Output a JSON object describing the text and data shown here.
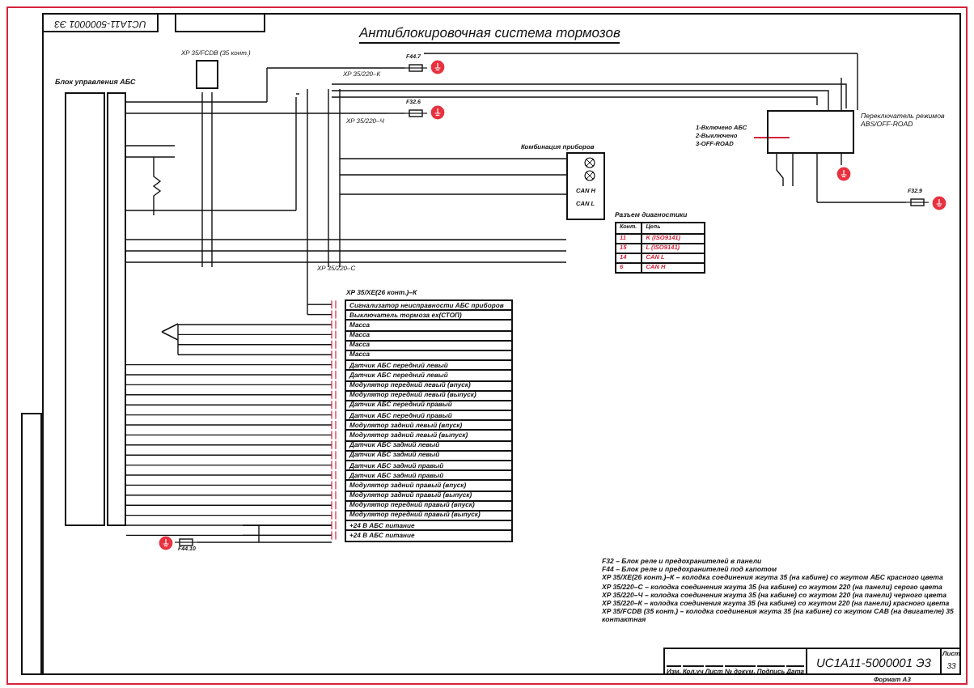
{
  "title": "Антиблокировочная система тормозов",
  "doc_code_mirrored": "UC1A11-5000001 Э3",
  "ecu": {
    "label": "Блок управления АБС"
  },
  "connectors": [
    "XP 35/FCDB (35 конт.)",
    "XP 35/220–К",
    "XP 35/220–Ч",
    "XP 35/220–С"
  ],
  "fuses": [
    "F44.7",
    "F32.6",
    "F44.10",
    "F32.9"
  ],
  "instrument_cluster": {
    "label": "Комбинация приборов",
    "signals": [
      "CAN H",
      "CAN L"
    ]
  },
  "switch": {
    "label": "Переключатель режимов ABS/OFF-ROAD",
    "positions": [
      "1-Включено АБС",
      "2-Выключено",
      "3-OFF-ROAD"
    ]
  },
  "diag": {
    "title": "Разъем диагностики",
    "columns": [
      "Конт.",
      "Цепь"
    ],
    "rows": [
      [
        "11",
        "K (ISO9141)"
      ],
      [
        "15",
        "L (ISO9141)"
      ],
      [
        "14",
        "CAN L"
      ],
      [
        "6",
        "CAN H"
      ]
    ]
  },
  "harness": {
    "title": "XP 35/XE(26 конт.)–К",
    "rows": [
      "Сигнализатор неисправности АБС приборов",
      "Выключатель тормоза ex(СТОП)",
      "Масса",
      "Масса",
      "Масса",
      "Масса",
      "Датчик АБС передний левый",
      "Датчик АБС передний левый",
      "Модулятор передний левый (впуск)",
      "Модулятор передний левый (выпуск)",
      "Датчик АБС передний правый",
      "Датчик АБС передний правый",
      "Модулятор задний левый (впуск)",
      "Модулятор задний левый (выпуск)",
      "Датчик АБС задний левый",
      "Датчик АБС задний левый",
      "Датчик АБС задний правый",
      "Датчик АБС задний правый",
      "Модулятор задний правый (впуск)",
      "Модулятор задний правый (выпуск)",
      "Модулятор передний правый (впуск)",
      "Модулятор передний правый (выпуск)",
      "+24 В АБС питание",
      "+24 В АБС питание"
    ]
  },
  "legend": [
    "F32 – Блок реле и предохранителей в панели",
    "F44 – Блок реле и предохранителей под капотом",
    "XP 35/XE(26 конт.)–К – колодка соединения жгута 35 (на кабине) со жгутом АБС красного цвета",
    "XP 35/220–С – колодка соединения жгута 35 (на кабине) со жгутом 220 (на панели) серого цвета",
    "XP 35/220–Ч – колодка соединения жгута 35 (на кабине) со жгутом 220 (на панели) черного цвета",
    "XP 35/220–К – колодка соединения жгута 35 (на кабине) со жгутом 220 (на панели) красного цвета",
    "XP 35/FCDB (35 конт.) – колодка соединения жгута 35 (на кабине) со жгутом CAB (на двигателе) 35 контактная"
  ],
  "stamp": {
    "columns": [
      "Изм.",
      "Кол.уч",
      "Лист",
      "№ докум.",
      "Подпись",
      "Дата"
    ],
    "code": "UC1A11-5000001 Э3",
    "sheet_label": "Лист",
    "sheet": "33",
    "format": "Формат А3"
  }
}
